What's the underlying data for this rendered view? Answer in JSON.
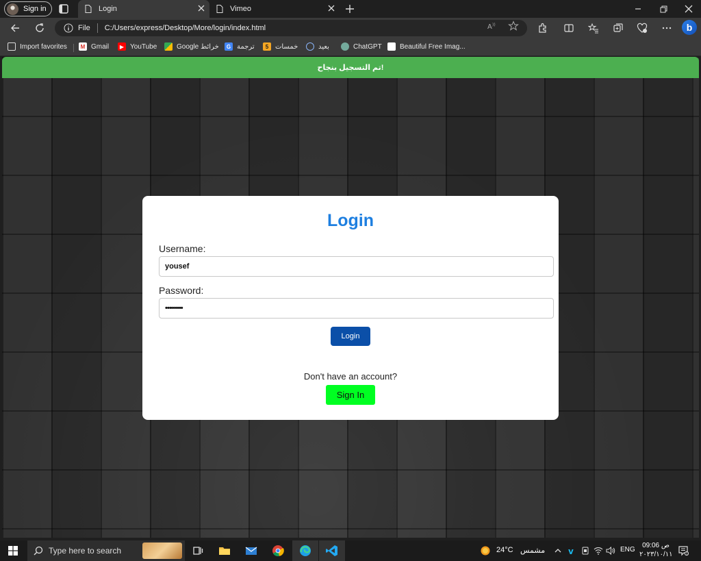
{
  "browser": {
    "profile_label": "Sign in",
    "tabs": [
      {
        "title": "Login",
        "active": true
      },
      {
        "title": "Vimeo",
        "active": false
      }
    ],
    "address": {
      "scheme_label": "File",
      "url": "C:/Users/express/Desktop/More/login/index.html"
    },
    "favorites": [
      {
        "label": "Import favorites",
        "icon": "import-icon"
      },
      {
        "label": "Gmail",
        "icon": "gmail-icon"
      },
      {
        "label": "YouTube",
        "icon": "youtube-icon"
      },
      {
        "label": "Google خرائط",
        "icon": "maps-icon"
      },
      {
        "label": "ترجمة",
        "icon": "translate-icon"
      },
      {
        "label": "خمسات",
        "icon": "khamsat-icon",
        "glyph": "5"
      },
      {
        "label": "بعيد",
        "icon": "baeed-icon"
      },
      {
        "label": "ChatGPT",
        "icon": "chatgpt-icon"
      },
      {
        "label": "Beautiful Free Imag...",
        "icon": "unsplash-icon"
      }
    ],
    "bing_glyph": "b"
  },
  "page": {
    "banner": "!تم التسجيل بنجاح",
    "form": {
      "title": "Login",
      "username_label": "Username:",
      "username_value": "yousef",
      "password_label": "Password:",
      "password_value": "•••••••••",
      "login_button": "Login",
      "no_account_text": "Don't have an account?",
      "signin_button": "Sign In"
    }
  },
  "taskbar": {
    "search_placeholder": "Type here to search",
    "weather_temp": "24°C",
    "weather_desc": "مشمس",
    "language": "ENG",
    "time": "ص 09:06",
    "date": "٢٠٢٣/١٠/١١"
  },
  "colors": {
    "banner_green": "#4caf50",
    "title_blue": "#1e7fe0",
    "login_button": "#0b4fa8",
    "signin_button": "#00ff22"
  }
}
